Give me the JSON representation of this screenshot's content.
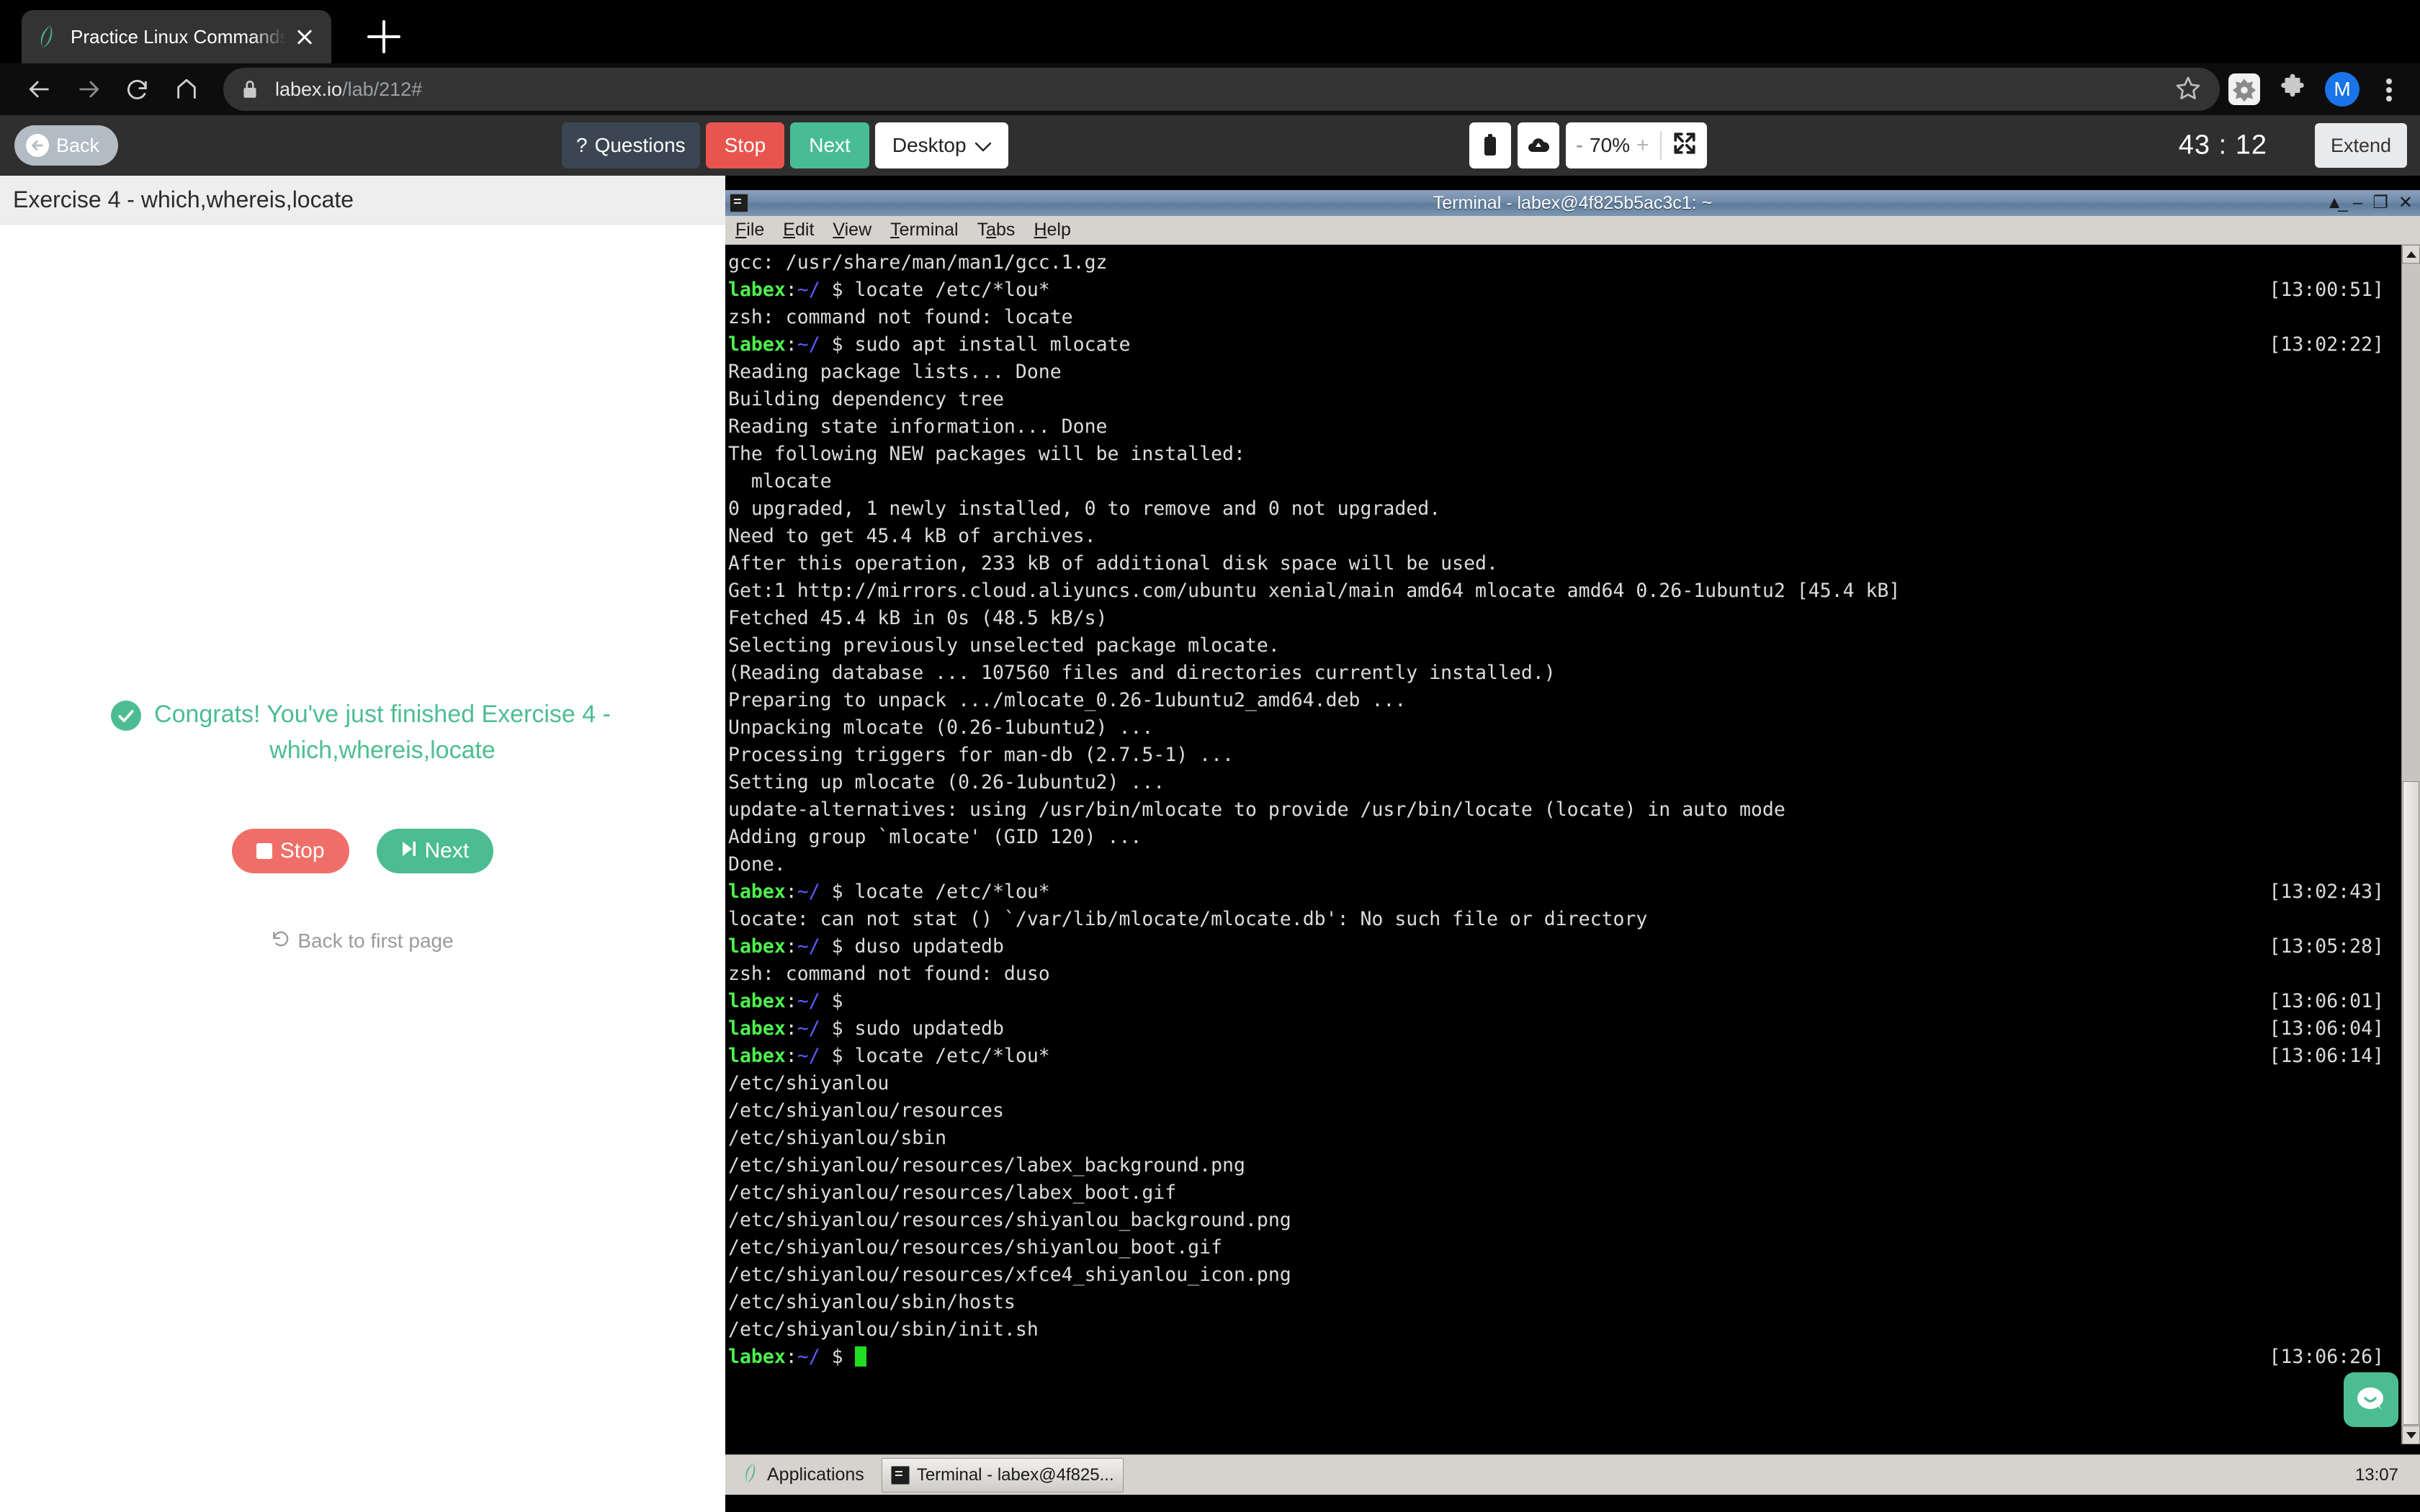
{
  "browser": {
    "tab_title": "Practice Linux Commands - Exe",
    "favicon": "labex-leaf-icon",
    "new_tab_label": "+",
    "url_host": "labex.io",
    "url_path": "/lab/212#",
    "profile_initial": "M",
    "nav": {
      "back": "back-arrow-icon",
      "forward": "forward-arrow-icon",
      "reload": "reload-icon",
      "home": "home-icon"
    }
  },
  "toolbar": {
    "back_label": "Back",
    "questions_label": "Questions",
    "questions_mark": "?",
    "stop_label": "Stop",
    "next_label": "Next",
    "desktop_label": "Desktop",
    "desktop_caret": "⌄",
    "clipboard_icon": "clipboard-icon",
    "cloud_icon": "cloud-upload-icon",
    "zoom_minus": "-",
    "zoom_level": "70%",
    "zoom_plus": "+",
    "fullscreen_icon": "fullscreen-icon",
    "timer": "43 : 12",
    "extend_label": "Extend"
  },
  "left_panel": {
    "header_title": "Exercise 4 - which,whereis,locate",
    "congrats_text": "Congrats! You've just finished Exercise 4 - which,whereis,locate",
    "stop_label": "Stop",
    "next_label": "Next",
    "back_to_first_label": "Back to first page",
    "check_icon": "check-circle-icon",
    "undo_icon": "undo-arrow-icon",
    "colors": {
      "accent_green": "#4cbd92",
      "accent_red": "#ef6f68"
    }
  },
  "terminal": {
    "window_title": "Terminal - labex@4f825b5ac3c1: ~",
    "menu": [
      "File",
      "Edit",
      "View",
      "Terminal",
      "Tabs",
      "Help"
    ],
    "window_controls": [
      "shade-icon",
      "minimize-icon",
      "maximize-icon",
      "close-icon"
    ],
    "prompt": {
      "user": "labex",
      "colon": ":",
      "path": "~/",
      "sigil": "$"
    },
    "lines": [
      {
        "type": "out",
        "text": "gcc: /usr/share/man/man1/gcc.1.gz"
      },
      {
        "type": "cmd",
        "text": "locate /etc/*lou*",
        "ts": "[13:00:51]"
      },
      {
        "type": "out",
        "text": "zsh: command not found: locate"
      },
      {
        "type": "cmd",
        "text": "sudo apt install mlocate",
        "ts": "[13:02:22]"
      },
      {
        "type": "out",
        "text": "Reading package lists... Done"
      },
      {
        "type": "out",
        "text": "Building dependency tree"
      },
      {
        "type": "out",
        "text": "Reading state information... Done"
      },
      {
        "type": "out",
        "text": "The following NEW packages will be installed:"
      },
      {
        "type": "out",
        "text": "  mlocate"
      },
      {
        "type": "out",
        "text": "0 upgraded, 1 newly installed, 0 to remove and 0 not upgraded."
      },
      {
        "type": "out",
        "text": "Need to get 45.4 kB of archives."
      },
      {
        "type": "out",
        "text": "After this operation, 233 kB of additional disk space will be used."
      },
      {
        "type": "out",
        "text": "Get:1 http://mirrors.cloud.aliyuncs.com/ubuntu xenial/main amd64 mlocate amd64 0.26-1ubuntu2 [45.4 kB]"
      },
      {
        "type": "out",
        "text": "Fetched 45.4 kB in 0s (48.5 kB/s)"
      },
      {
        "type": "out",
        "text": "Selecting previously unselected package mlocate."
      },
      {
        "type": "out",
        "text": "(Reading database ... 107560 files and directories currently installed.)"
      },
      {
        "type": "out",
        "text": "Preparing to unpack .../mlocate_0.26-1ubuntu2_amd64.deb ..."
      },
      {
        "type": "out",
        "text": "Unpacking mlocate (0.26-1ubuntu2) ..."
      },
      {
        "type": "out",
        "text": "Processing triggers for man-db (2.7.5-1) ..."
      },
      {
        "type": "out",
        "text": "Setting up mlocate (0.26-1ubuntu2) ..."
      },
      {
        "type": "out",
        "text": "update-alternatives: using /usr/bin/mlocate to provide /usr/bin/locate (locate) in auto mode"
      },
      {
        "type": "out",
        "text": "Adding group `mlocate' (GID 120) ..."
      },
      {
        "type": "out",
        "text": "Done."
      },
      {
        "type": "cmd",
        "text": "locate /etc/*lou*",
        "ts": "[13:02:43]"
      },
      {
        "type": "out",
        "text": "locate: can not stat () `/var/lib/mlocate/mlocate.db': No such file or directory"
      },
      {
        "type": "cmd",
        "text": "duso updatedb",
        "ts": "[13:05:28]"
      },
      {
        "type": "out",
        "text": "zsh: command not found: duso"
      },
      {
        "type": "cmd",
        "text": "",
        "ts": "[13:06:01]"
      },
      {
        "type": "cmd",
        "text": "sudo updatedb",
        "ts": "[13:06:04]"
      },
      {
        "type": "cmd",
        "text": "locate /etc/*lou*",
        "ts": "[13:06:14]"
      },
      {
        "type": "out",
        "text": "/etc/shiyanlou"
      },
      {
        "type": "out",
        "text": "/etc/shiyanlou/resources"
      },
      {
        "type": "out",
        "text": "/etc/shiyanlou/sbin"
      },
      {
        "type": "out",
        "text": "/etc/shiyanlou/resources/labex_background.png"
      },
      {
        "type": "out",
        "text": "/etc/shiyanlou/resources/labex_boot.gif"
      },
      {
        "type": "out",
        "text": "/etc/shiyanlou/resources/shiyanlou_background.png"
      },
      {
        "type": "out",
        "text": "/etc/shiyanlou/resources/shiyanlou_boot.gif"
      },
      {
        "type": "out",
        "text": "/etc/shiyanlou/resources/xfce4_shiyanlou_icon.png"
      },
      {
        "type": "out",
        "text": "/etc/shiyanlou/sbin/hosts"
      },
      {
        "type": "out",
        "text": "/etc/shiyanlou/sbin/init.sh"
      },
      {
        "type": "cursor",
        "text": "",
        "ts": "[13:06:26]"
      }
    ]
  },
  "desktop": {
    "applications_label": "Applications",
    "task_label": "Terminal - labex@4f825...",
    "clock": "13:07",
    "chat_icon": "chat-bubble-icon"
  }
}
